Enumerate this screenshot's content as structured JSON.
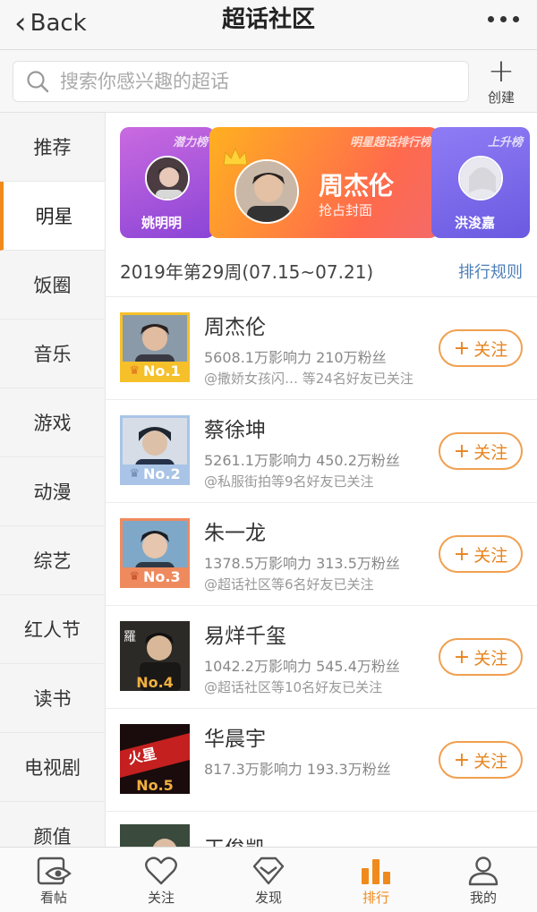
{
  "header": {
    "back_label": "Back",
    "title": "超话社区"
  },
  "search": {
    "placeholder": "搜索你感兴趣的超话",
    "create_label": "创建"
  },
  "sidebar": {
    "items": [
      {
        "label": "推荐"
      },
      {
        "label": "明星"
      },
      {
        "label": "饭圈"
      },
      {
        "label": "音乐"
      },
      {
        "label": "游戏"
      },
      {
        "label": "动漫"
      },
      {
        "label": "综艺"
      },
      {
        "label": "红人节"
      },
      {
        "label": "读书"
      },
      {
        "label": "电视剧"
      },
      {
        "label": "颜值"
      }
    ],
    "active_index": 1
  },
  "banner": {
    "left": {
      "tag": "潜力榜",
      "name": "姚明明"
    },
    "center": {
      "tag": "明星超话排行榜",
      "name": "周杰伦",
      "sub": "抢占封面"
    },
    "right": {
      "tag": "上升榜",
      "name": "洪浚嘉"
    }
  },
  "week": {
    "label": "2019年第29周(07.15~07.21)",
    "rule_label": "排行规则"
  },
  "follow_label": "关注",
  "rankings": [
    {
      "name": "周杰伦",
      "stats": "5608.1万影响力 210万粉丝",
      "friends": "@撒娇女孩闪… 等24名好友已关注",
      "rank": "No.1",
      "color": "#f5c02a"
    },
    {
      "name": "蔡徐坤",
      "stats": "5261.1万影响力 450.2万粉丝",
      "friends": "@私服街拍等9名好友已关注",
      "rank": "No.2",
      "color": "#a9c4e6"
    },
    {
      "name": "朱一龙",
      "stats": "1378.5万影响力 313.5万粉丝",
      "friends": "@超话社区等6名好友已关注",
      "rank": "No.3",
      "color": "#ef8a5e"
    },
    {
      "name": "易烊千玺",
      "stats": "1042.2万影响力 545.4万粉丝",
      "friends": "@超话社区等10名好友已关注",
      "rank": "No.4",
      "color": "#f0b040"
    },
    {
      "name": "华晨宇",
      "stats": "817.3万影响力 193.3万粉丝",
      "friends": "",
      "rank": "No.5",
      "color": "#f0b040"
    },
    {
      "name": "王俊凯",
      "stats": "",
      "friends": "",
      "rank": "",
      "color": "#f0b040"
    }
  ],
  "tabs": [
    {
      "label": "看帖",
      "icon": "eye-card-icon"
    },
    {
      "label": "关注",
      "icon": "heart-icon"
    },
    {
      "label": "发现",
      "icon": "diamond-icon"
    },
    {
      "label": "排行",
      "icon": "bars-icon"
    },
    {
      "label": "我的",
      "icon": "person-icon"
    }
  ],
  "active_tab": 3
}
